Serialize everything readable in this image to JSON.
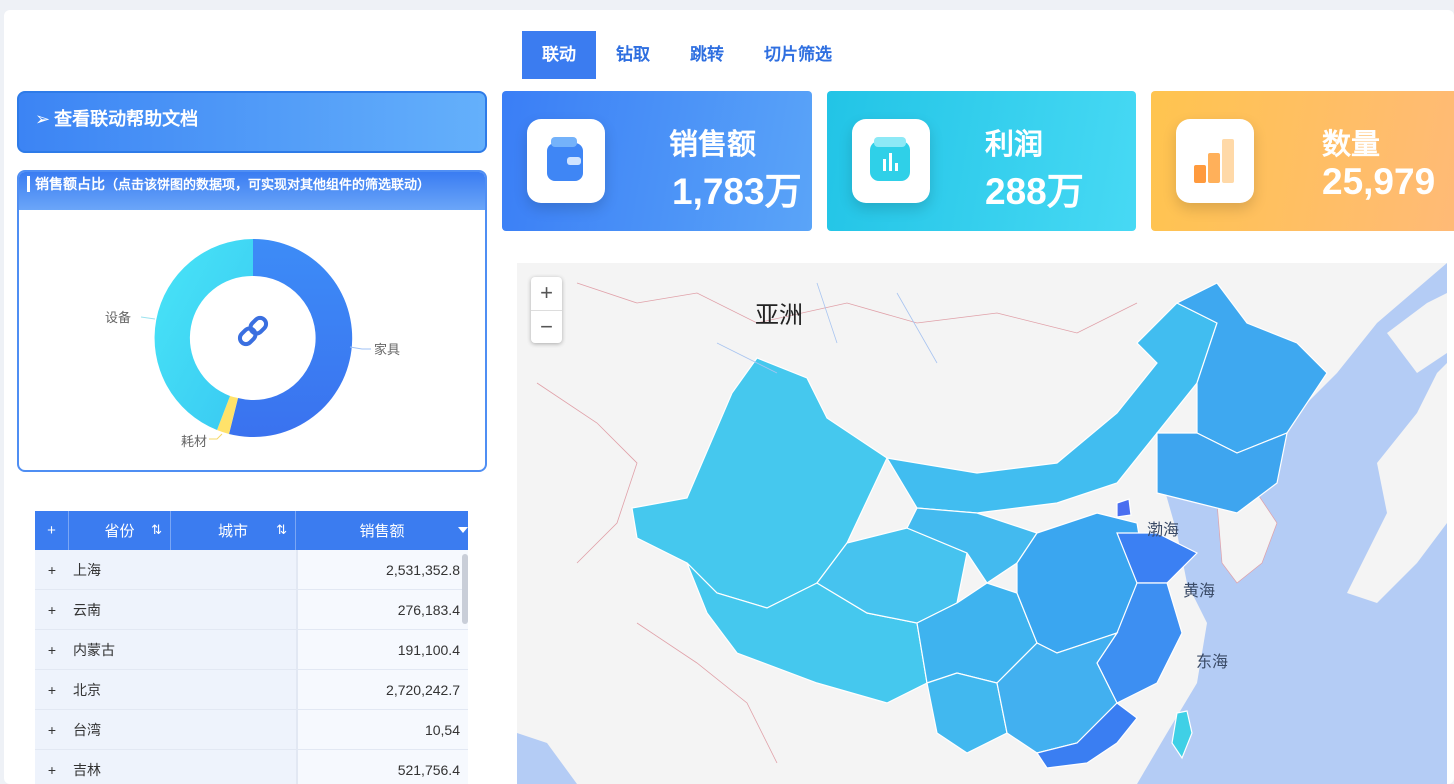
{
  "tabs": [
    "联动",
    "钻取",
    "跳转",
    "切片筛选"
  ],
  "help_link": "查看联动帮助文档",
  "pie": {
    "title": "销售额占比",
    "subtitle": "（点击该饼图的数据项，可实现对其他组件的筛选联动）",
    "labels": {
      "furniture": "家具",
      "equipment": "设备",
      "consumables": "耗材"
    }
  },
  "kpis": [
    {
      "label": "销售额",
      "value": "1,783万",
      "icon": "wallet-icon"
    },
    {
      "label": "利润",
      "value": "288万",
      "icon": "bar-chart-icon"
    },
    {
      "label": "数量",
      "value": "25,979",
      "icon": "stacked-bars-icon"
    }
  ],
  "table": {
    "headers": {
      "province": "省份",
      "city": "城市",
      "sales": "销售额"
    },
    "rows": [
      {
        "province": "上海",
        "sales": "2,531,352.8"
      },
      {
        "province": "云南",
        "sales": "276,183.4"
      },
      {
        "province": "内蒙古",
        "sales": "191,100.4"
      },
      {
        "province": "北京",
        "sales": "2,720,242.7"
      },
      {
        "province": "台湾",
        "sales": "10,54"
      },
      {
        "province": "吉林",
        "sales": "521,756.4"
      }
    ]
  },
  "map": {
    "zoom_in": "+",
    "zoom_out": "−",
    "labels": {
      "asia": "亚洲",
      "bohai": "渤海",
      "yellow_sea": "黄海",
      "east_sea": "东海"
    }
  },
  "colors": {
    "accent": "#3b7cf0",
    "cyan": "#22c4e6",
    "orange": "#ffc44f"
  }
}
